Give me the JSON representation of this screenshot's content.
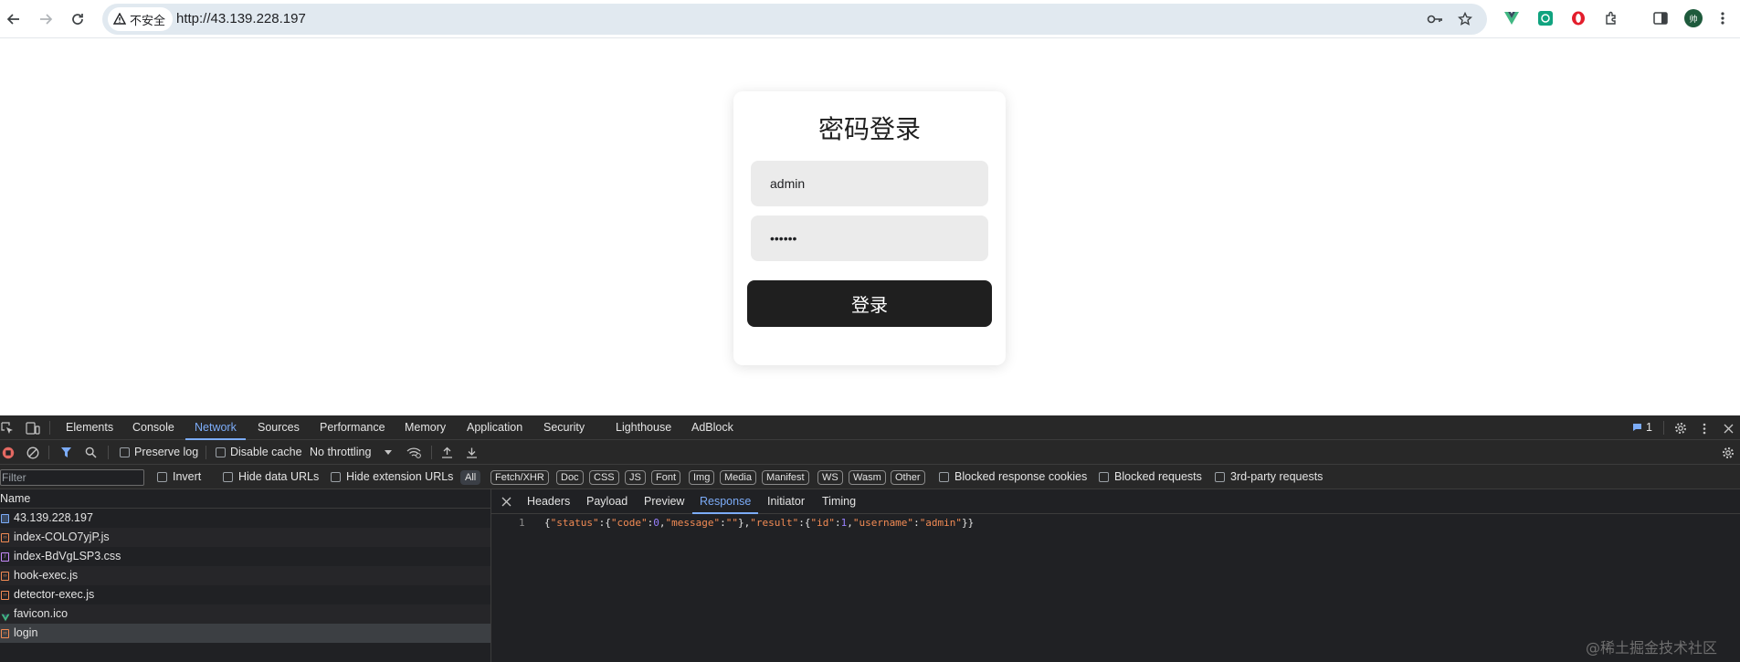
{
  "browser": {
    "security_label": "不安全",
    "url": "http://43.139.228.197",
    "avatar_initial": "帅"
  },
  "page": {
    "login_title": "密码登录",
    "username_value": "admin",
    "password_value": "••••••",
    "login_button": "登录"
  },
  "devtools": {
    "tabs": [
      "Elements",
      "Console",
      "Network",
      "Sources",
      "Performance",
      "Memory",
      "Application",
      "Security",
      "Lighthouse",
      "AdBlock"
    ],
    "active_tab": "Network",
    "issues_count": "1",
    "toolbar": {
      "preserve_log": "Preserve log",
      "disable_cache": "Disable cache",
      "throttling": "No throttling"
    },
    "filterbar": {
      "placeholder": "Filter",
      "invert": "Invert",
      "hide_data_urls": "Hide data URLs",
      "hide_extension_urls": "Hide extension URLs",
      "types": [
        "All",
        "Fetch/XHR",
        "Doc",
        "CSS",
        "JS",
        "Font",
        "Img",
        "Media",
        "Manifest",
        "WS",
        "Wasm",
        "Other"
      ],
      "blocked_response_cookies": "Blocked response cookies",
      "blocked_requests": "Blocked requests",
      "third_party_requests": "3rd-party requests"
    },
    "list": {
      "header": "Name",
      "rows": [
        "43.139.228.197",
        "index-COLO7yjP.js",
        "index-BdVgLSP3.css",
        "hook-exec.js",
        "detector-exec.js",
        "favicon.ico",
        "login"
      ]
    },
    "detail": {
      "tabs": [
        "Headers",
        "Payload",
        "Preview",
        "Response",
        "Initiator",
        "Timing"
      ],
      "active_tab": "Response",
      "line_number": "1",
      "response_text": "{\"status\":{\"code\":0,\"message\":\"\"},\"result\":{\"id\":1,\"username\":\"admin\"}}"
    }
  },
  "watermark": "@稀土掘金技术社区",
  "colors": {
    "accent": "#7cacf8",
    "devtools_bg": "#202124",
    "button_dark": "#1f1f1f",
    "record_red": "#e46962"
  }
}
